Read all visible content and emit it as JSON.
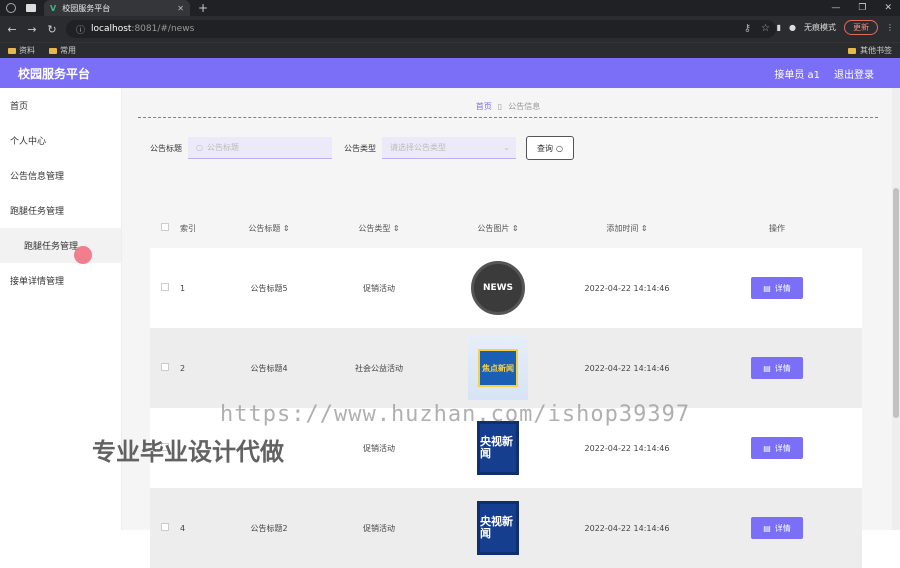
{
  "browser": {
    "tab_title": "校园服务平台",
    "url_host": "localhost",
    "url_path": ":8081/#/news",
    "incognito_label": "无痕模式",
    "update_label": "更新",
    "bookmarks": [
      "资料",
      "常用"
    ],
    "other_bookmarks": "其他书签"
  },
  "app": {
    "logo": "校园服务平台",
    "user": "接单员 a1",
    "logout": "退出登录"
  },
  "sidebar": {
    "items": [
      {
        "label": "首页"
      },
      {
        "label": "个人中心"
      },
      {
        "label": "公告信息管理"
      },
      {
        "label": "跑腿任务管理"
      },
      {
        "label": "跑腿任务管理"
      },
      {
        "label": "接单详情管理"
      }
    ]
  },
  "breadcrumb": {
    "home": "首页",
    "current": "公告信息"
  },
  "search": {
    "title_label": "公告标题",
    "title_placeholder": "公告标题",
    "type_label": "公告类型",
    "type_placeholder": "请选择公告类型",
    "query_button": "查询"
  },
  "table": {
    "headers": [
      "索引",
      "公告标题",
      "公告类型",
      "公告图片",
      "添加时间",
      "操作"
    ],
    "rows": [
      {
        "index": "1",
        "title": "公告标题5",
        "type": "促销活动",
        "image": "NEWS",
        "time": "2022-04-22 14:14:46",
        "action": "详情"
      },
      {
        "index": "2",
        "title": "公告标题4",
        "type": "社会公益活动",
        "image": "焦点新闻",
        "time": "2022-04-22 14:14:46",
        "action": "详情"
      },
      {
        "index": "",
        "title": "",
        "type": "促销活动",
        "image": "央视新闻",
        "time": "2022-04-22 14:14:46",
        "action": "详情"
      },
      {
        "index": "4",
        "title": "公告标题2",
        "type": "促销活动",
        "image": "央视新闻",
        "time": "2022-04-22 14:14:46",
        "action": "详情"
      }
    ]
  },
  "watermark": {
    "url": "https://www.huzhan.com/ishop39397",
    "text": "专业毕业设计代做"
  },
  "colors": {
    "accent": "#7b6ff7",
    "cursor": "#f06a7a"
  }
}
